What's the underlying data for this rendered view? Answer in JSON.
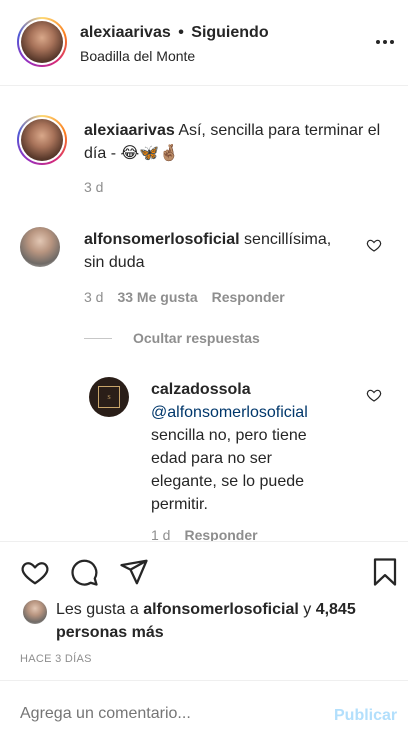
{
  "header": {
    "username": "alexiaarivas",
    "separator": "•",
    "follow_status": "Siguiendo",
    "location": "Boadilla del Monte"
  },
  "caption": {
    "username": "alexiaarivas",
    "text": "Así, sencilla para terminar el día - 😂🦋🤞🏽",
    "time": "3 d"
  },
  "comments": [
    {
      "username": "alfonsomerlosoficial",
      "text": "sencillísima, sin duda",
      "time": "3 d",
      "likes": "33 Me gusta",
      "reply": "Responder"
    }
  ],
  "hide_replies": "Ocultar respuestas",
  "reply": {
    "username": "calzadossola",
    "mention": "@alfonsomerlosoficial",
    "text": "sencilla no, pero tiene edad para no ser elegante, se lo puede permitir.",
    "time": "1 d",
    "reply": "Responder"
  },
  "likes": {
    "prefix": "Les gusta a",
    "user": "alfonsomerlosoficial",
    "connector": "y",
    "others": "4,845 personas más"
  },
  "post_time": "HACE 3 DÍAS",
  "add_comment": {
    "placeholder": "Agrega un comentario...",
    "publish": "Publicar"
  },
  "icons": {
    "more": "more-horizontal-icon",
    "like": "heart-icon",
    "comment": "comment-icon",
    "share": "paper-plane-icon",
    "save": "bookmark-icon"
  },
  "colors": {
    "text": "#262626",
    "muted": "#8e8e8e",
    "link": "#00376b",
    "publish_disabled": "#b2dffc"
  }
}
